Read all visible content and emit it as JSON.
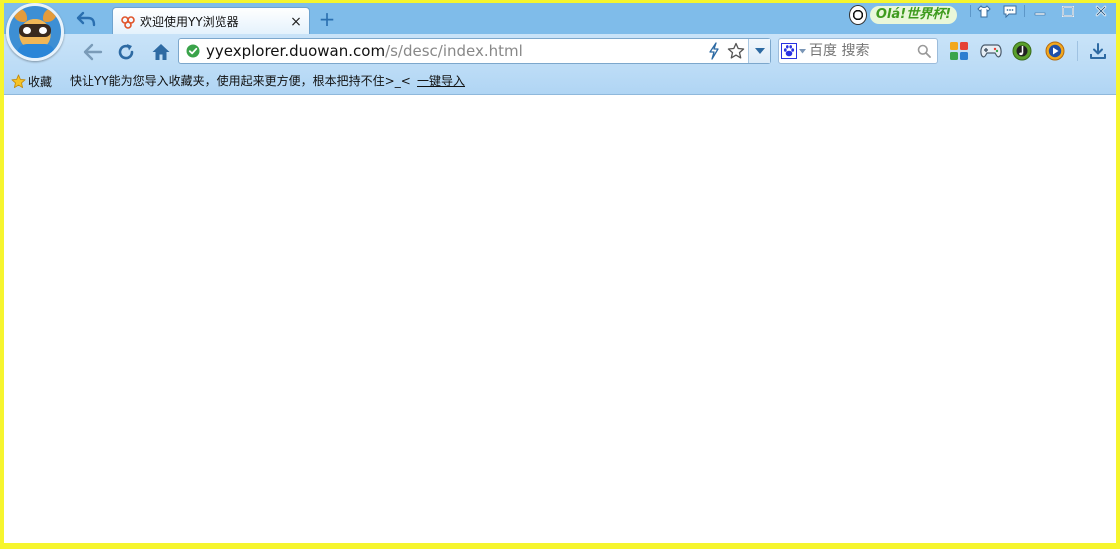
{
  "window": {
    "tab": {
      "title": "欢迎使用YY浏览器",
      "close_label": "×"
    },
    "newtab_label": "+",
    "promo": {
      "text": "Olá!世界杯!",
      "icon": "soccer-ball-icon"
    }
  },
  "toolbar": {
    "address": {
      "url_host": "yyexplorer.duowan.com",
      "url_path": "/s/desc/index.html"
    },
    "search": {
      "placeholder": "百度 搜索",
      "engine_icon": "baidu-paw-icon"
    },
    "icons": [
      "back-arrow-icon",
      "refresh-icon",
      "home-icon",
      "lightning-icon",
      "star-icon",
      "apps-grid-icon",
      "gamepad-icon",
      "music-note-icon",
      "video-play-icon",
      "download-icon"
    ]
  },
  "bookmarks": {
    "favorites_label": "收藏",
    "hint_text": "快让YY能为您导入收藏夹，使用起来更方便，根本把持不住>_<",
    "import_label": "一键导入"
  },
  "colors": {
    "frame": "#f6f52e",
    "titlebar": "#7fbcea",
    "toolbar": "#c9e3f8",
    "accent": "#2a6fb0"
  }
}
